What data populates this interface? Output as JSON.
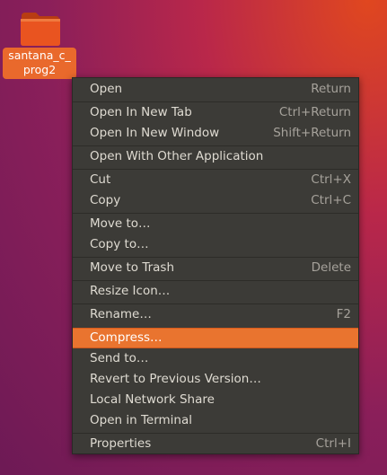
{
  "desktop": {
    "icon_label_line1": "santana_c_",
    "icon_label_line2": "prog2",
    "icon": "folder-icon"
  },
  "menu": {
    "items": [
      {
        "label": "Open",
        "accel": "Return"
      },
      {
        "label": "Open In New Tab",
        "accel": "Ctrl+Return"
      },
      {
        "label": "Open In New Window",
        "accel": "Shift+Return"
      },
      {
        "label": "Open With Other Application",
        "accel": ""
      },
      {
        "label": "Cut",
        "accel": "Ctrl+X"
      },
      {
        "label": "Copy",
        "accel": "Ctrl+C"
      },
      {
        "label": "Move to…",
        "accel": ""
      },
      {
        "label": "Copy to…",
        "accel": ""
      },
      {
        "label": "Move to Trash",
        "accel": "Delete"
      },
      {
        "label": "Resize Icon…",
        "accel": ""
      },
      {
        "label": "Rename…",
        "accel": "F2"
      },
      {
        "label": "Compress…",
        "accel": "",
        "highlighted": true
      },
      {
        "label": "Send to…",
        "accel": ""
      },
      {
        "label": "Revert to Previous Version…",
        "accel": ""
      },
      {
        "label": "Local Network Share",
        "accel": ""
      },
      {
        "label": "Open in Terminal",
        "accel": ""
      },
      {
        "label": "Properties",
        "accel": "Ctrl+I"
      }
    ]
  },
  "colors": {
    "menu_bg": "#3c3b37",
    "highlight": "#e9742f",
    "icon_label_bg": "#e9692c",
    "folder": "#e95420"
  }
}
